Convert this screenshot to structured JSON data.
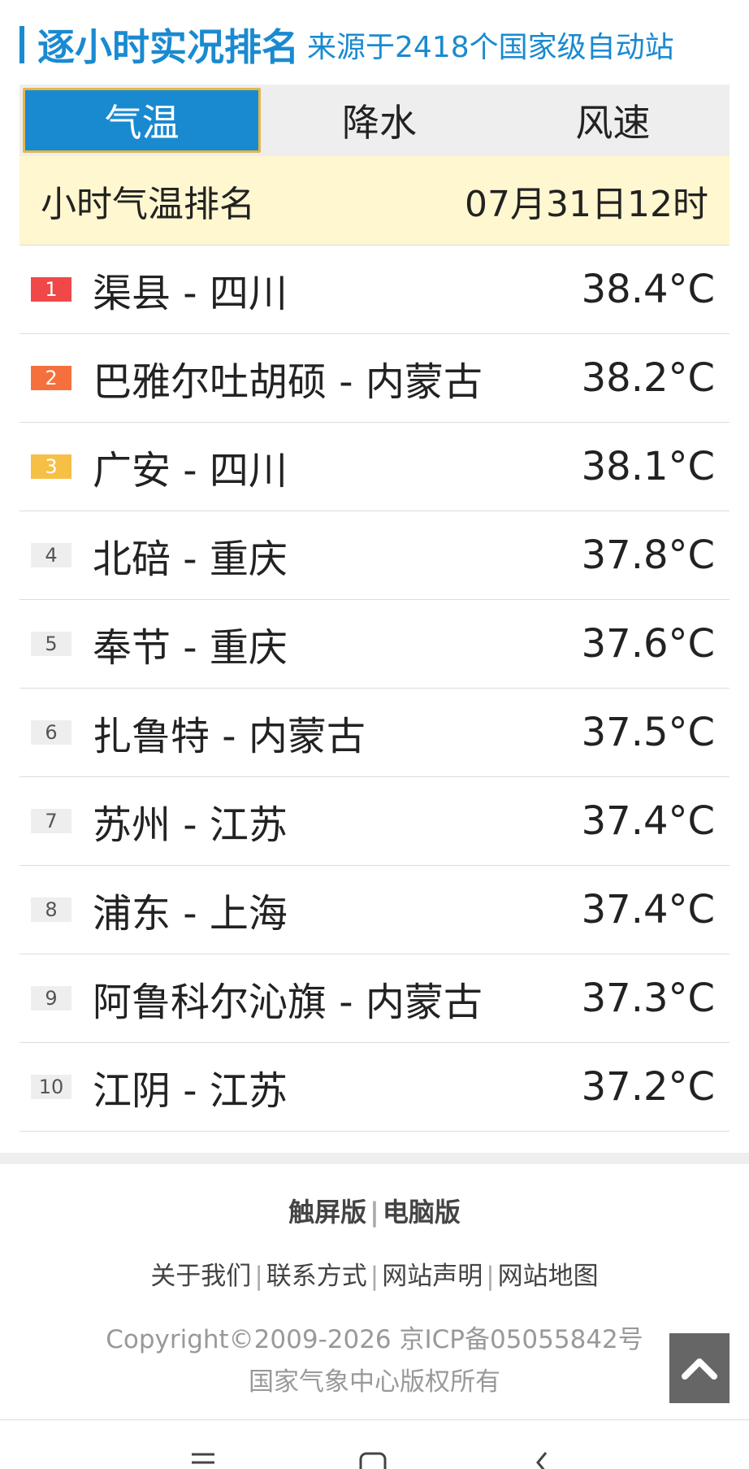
{
  "header": {
    "title": "逐小时实况排名",
    "source": "来源于2418个国家级自动站"
  },
  "tabs": [
    {
      "label": "气温",
      "active": true
    },
    {
      "label": "降水",
      "active": false
    },
    {
      "label": "风速",
      "active": false
    }
  ],
  "info": {
    "label": "小时气温排名",
    "time": "07月31日12时"
  },
  "ranking": [
    {
      "rank": "1",
      "name": "渠县 - 四川",
      "value": "38.4°C"
    },
    {
      "rank": "2",
      "name": "巴雅尔吐胡硕 - 内蒙古",
      "value": "38.2°C"
    },
    {
      "rank": "3",
      "name": "广安 - 四川",
      "value": "38.1°C"
    },
    {
      "rank": "4",
      "name": "北碚 - 重庆",
      "value": "37.8°C"
    },
    {
      "rank": "5",
      "name": "奉节 - 重庆",
      "value": "37.6°C"
    },
    {
      "rank": "6",
      "name": "扎鲁特 - 内蒙古",
      "value": "37.5°C"
    },
    {
      "rank": "7",
      "name": "苏州 - 江苏",
      "value": "37.4°C"
    },
    {
      "rank": "8",
      "name": "浦东 - 上海",
      "value": "37.4°C"
    },
    {
      "rank": "9",
      "name": "阿鲁科尔沁旗 - 内蒙古",
      "value": "37.3°C"
    },
    {
      "rank": "10",
      "name": "江阴 - 江苏",
      "value": "37.2°C"
    }
  ],
  "footer": {
    "versions": [
      "触屏版",
      "电脑版"
    ],
    "links": [
      "关于我们",
      "联系方式",
      "网站声明",
      "网站地图"
    ],
    "copyright": "Copyright©2009-2026 京ICP备05055842号",
    "owner": "国家气象中心版权所有"
  },
  "colors": {
    "accent": "#1a8ad0",
    "rank1": "#f04848",
    "rank2": "#f5703d",
    "rank3": "#f6c046",
    "info_bg": "#fff7cf"
  },
  "icons": {
    "back_to_top": "chevron-up-icon",
    "nav": [
      "menu-icon",
      "home-icon",
      "back-icon"
    ]
  }
}
